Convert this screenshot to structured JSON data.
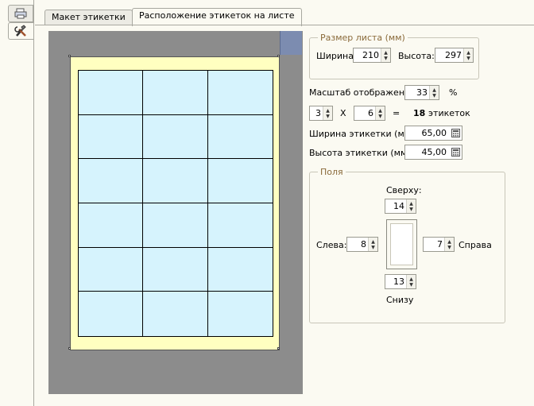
{
  "tabs": [
    {
      "label": "Макет этикетки"
    },
    {
      "label": "Расположение этикеток на листе"
    }
  ],
  "left_toolbar": {
    "icons": [
      "print-preview-icon",
      "tools-icon"
    ]
  },
  "sheet_size": {
    "legend": "Размер листа (мм)",
    "width_label": "Ширина:",
    "width_value": "210",
    "height_label": "Высота:",
    "height_value": "297"
  },
  "scale": {
    "label": "Масштаб отображения:",
    "value": "33",
    "unit": "%"
  },
  "count": {
    "columns": "3",
    "times": "X",
    "rows": "6",
    "equals": "=",
    "total": "18",
    "total_suffix": "этикеток"
  },
  "label_width": {
    "label": "Ширина этикетки (мм):",
    "value": "65,00"
  },
  "label_height": {
    "label": "Высота этикетки (мм):",
    "value": "45,00"
  },
  "margins": {
    "legend": "Поля",
    "top_label": "Сверху:",
    "top_value": "14",
    "left_label": "Слева:",
    "left_value": "8",
    "right_label": "Справа",
    "right_value": "7",
    "bottom_label": "Снизу",
    "bottom_value": "13"
  },
  "preview_grid": {
    "columns": 3,
    "rows": 6
  }
}
